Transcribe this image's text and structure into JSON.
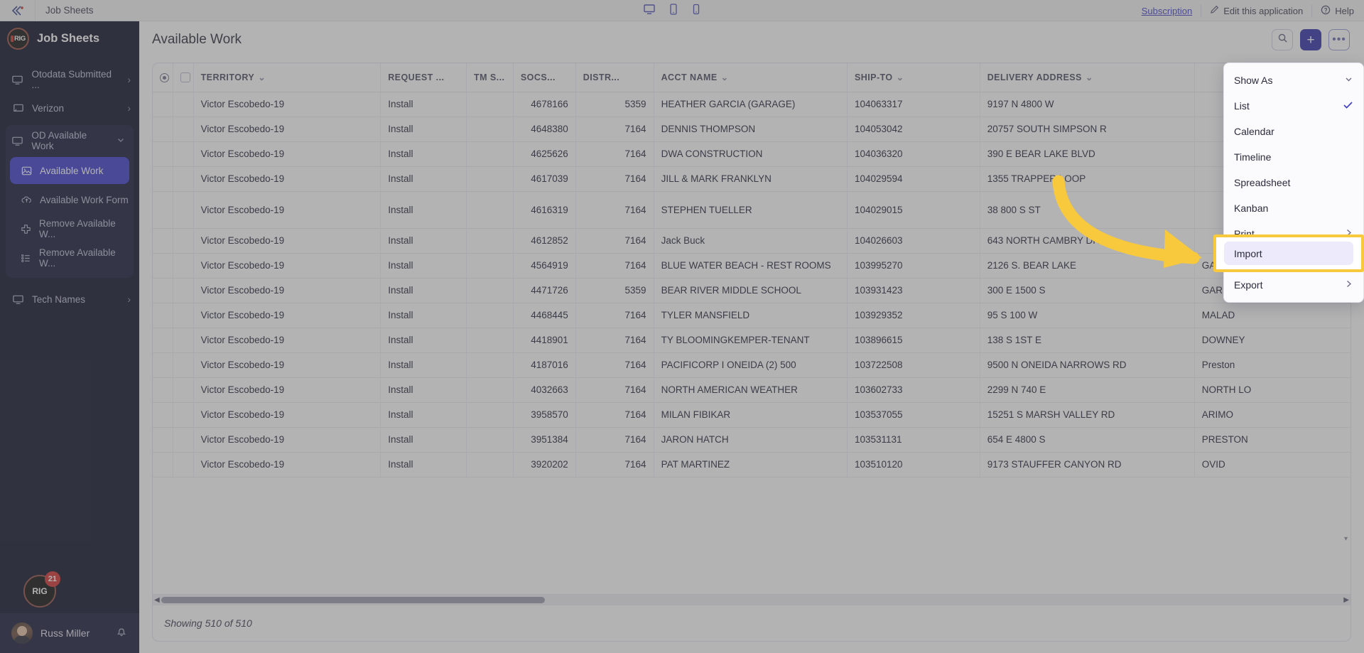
{
  "topbar": {
    "logo_icon": "chevron-logo-icon",
    "title": "Job Sheets",
    "device_icons": [
      "desktop-icon",
      "tablet-icon",
      "mobile-icon"
    ],
    "subscription_label": "Subscription",
    "edit_label": "Edit this application",
    "edit_icon": "pencil-icon",
    "help_label": "Help",
    "help_icon": "help-circle-icon"
  },
  "sidebar": {
    "app_title": "Job Sheets",
    "logo_text": "RIG",
    "items": [
      {
        "label": "Otodata Submitted ...",
        "icon": "monitor-icon",
        "chevron": "›"
      },
      {
        "label": "Verizon",
        "icon": "broadcast-screen-icon",
        "chevron": "›"
      }
    ],
    "group": {
      "label": "OD Available Work",
      "icon": "monitor-icon",
      "chevron": "⌄",
      "children": [
        {
          "label": "Available Work",
          "icon": "image-icon",
          "active": true
        },
        {
          "label": "Available Work Form",
          "icon": "cloud-upload-icon",
          "active": false
        },
        {
          "label": "Remove Available W...",
          "icon": "plus-cross-icon",
          "active": false
        },
        {
          "label": "Remove Available W...",
          "icon": "list-icon",
          "active": false
        }
      ]
    },
    "items_after": [
      {
        "label": "Tech Names",
        "icon": "monitor-icon",
        "chevron": "›"
      }
    ],
    "badge_count": "21",
    "user_name": "Russ Miller",
    "bell_icon": "bell-icon"
  },
  "page": {
    "title": "Available Work",
    "search_icon": "search-icon",
    "add_label": "+",
    "more_label": "•••"
  },
  "table": {
    "columns": [
      {
        "key": "sel",
        "label": ""
      },
      {
        "key": "chk",
        "label": ""
      },
      {
        "key": "territory",
        "label": "TERRITORY",
        "sortable": true
      },
      {
        "key": "request",
        "label": "REQUEST ...",
        "sortable": false
      },
      {
        "key": "tms",
        "label": "TM S...",
        "sortable": false
      },
      {
        "key": "socs",
        "label": "SOCS...",
        "sortable": false
      },
      {
        "key": "distr",
        "label": "DISTR...",
        "sortable": false
      },
      {
        "key": "acct",
        "label": "ACCT NAME",
        "sortable": true
      },
      {
        "key": "shipto",
        "label": "SHIP-TO",
        "sortable": true
      },
      {
        "key": "delivery",
        "label": "DELIVERY ADDRESS",
        "sortable": true
      },
      {
        "key": "city",
        "label": ""
      }
    ],
    "rows": [
      {
        "territory": "Victor Escobedo-19",
        "request": "Install",
        "tms": "",
        "socs": "4678166",
        "distr": "5359",
        "acct": "HEATHER GARCIA (GARAGE)",
        "shipto": "104063317",
        "delivery": "9197 N 4800 W",
        "city": "",
        "tall": false
      },
      {
        "territory": "Victor Escobedo-19",
        "request": "Install",
        "tms": "",
        "socs": "4648380",
        "distr": "7164",
        "acct": "DENNIS THOMPSON",
        "shipto": "104053042",
        "delivery": "20757 SOUTH SIMPSON R",
        "city": "",
        "tall": false
      },
      {
        "territory": "Victor Escobedo-19",
        "request": "Install",
        "tms": "",
        "socs": "4625626",
        "distr": "7164",
        "acct": "DWA CONSTRUCTION",
        "shipto": "104036320",
        "delivery": "390 E BEAR LAKE BLVD",
        "city": "",
        "tall": false
      },
      {
        "territory": "Victor Escobedo-19",
        "request": "Install",
        "tms": "",
        "socs": "4617039",
        "distr": "7164",
        "acct": "JILL & MARK FRANKLYN",
        "shipto": "104029594",
        "delivery": "1355 TRAPPER LOOP",
        "city": "",
        "tall": false
      },
      {
        "territory": "Victor Escobedo-19",
        "request": "Install",
        "tms": "",
        "socs": "4616319",
        "distr": "7164",
        "acct": "STEPHEN TUELLER",
        "shipto": "104029015",
        "delivery": "38  800 S ST",
        "city": "",
        "tall": true
      },
      {
        "territory": "Victor Escobedo-19",
        "request": "Install",
        "tms": "",
        "socs": "4612852",
        "distr": "7164",
        "acct": "Jack Buck",
        "shipto": "104026603",
        "delivery": "643 NORTH CAMBRY DRIV",
        "city": "",
        "tall": false
      },
      {
        "territory": "Victor Escobedo-19",
        "request": "Install",
        "tms": "",
        "socs": "4564919",
        "distr": "7164",
        "acct": "BLUE WATER BEACH - REST ROOMS",
        "shipto": "103995270",
        "delivery": "2126 S. BEAR LAKE",
        "city": "GARDEN C",
        "tall": false
      },
      {
        "territory": "Victor Escobedo-19",
        "request": "Install",
        "tms": "",
        "socs": "4471726",
        "distr": "5359",
        "acct": "BEAR RIVER MIDDLE SCHOOL",
        "shipto": "103931423",
        "delivery": "300 E 1500 S",
        "city": "GARLAND",
        "tall": false
      },
      {
        "territory": "Victor Escobedo-19",
        "request": "Install",
        "tms": "",
        "socs": "4468445",
        "distr": "7164",
        "acct": "TYLER MANSFIELD",
        "shipto": "103929352",
        "delivery": "95 S 100 W",
        "city": "MALAD",
        "tall": false
      },
      {
        "territory": "Victor Escobedo-19",
        "request": "Install",
        "tms": "",
        "socs": "4418901",
        "distr": "7164",
        "acct": "TY BLOOMINGKEMPER-TENANT",
        "shipto": "103896615",
        "delivery": "138 S 1ST E",
        "city": "DOWNEY",
        "tall": false
      },
      {
        "territory": "Victor Escobedo-19",
        "request": "Install",
        "tms": "",
        "socs": "4187016",
        "distr": "7164",
        "acct": "PACIFICORP I ONEIDA (2) 500",
        "shipto": "103722508",
        "delivery": "9500 N ONEIDA NARROWS RD",
        "city": "Preston",
        "tall": false
      },
      {
        "territory": "Victor Escobedo-19",
        "request": "Install",
        "tms": "",
        "socs": "4032663",
        "distr": "7164",
        "acct": "NORTH AMERICAN WEATHER",
        "shipto": "103602733",
        "delivery": "2299 N 740 E",
        "city": "NORTH LO",
        "tall": false
      },
      {
        "territory": "Victor Escobedo-19",
        "request": "Install",
        "tms": "",
        "socs": "3958570",
        "distr": "7164",
        "acct": "MILAN FIBIKAR",
        "shipto": "103537055",
        "delivery": "15251 S MARSH VALLEY RD",
        "city": "ARIMO",
        "tall": false
      },
      {
        "territory": "Victor Escobedo-19",
        "request": "Install",
        "tms": "",
        "socs": "3951384",
        "distr": "7164",
        "acct": "JARON HATCH",
        "shipto": "103531131",
        "delivery": "654 E 4800 S",
        "city": "PRESTON",
        "tall": false
      },
      {
        "territory": "Victor Escobedo-19",
        "request": "Install",
        "tms": "",
        "socs": "3920202",
        "distr": "7164",
        "acct": "PAT MARTINEZ",
        "shipto": "103510120",
        "delivery": "9173 STAUFFER CANYON RD",
        "city": "OVID",
        "tall": false
      }
    ],
    "footer_text": "Showing 510 of 510"
  },
  "menu": {
    "items": [
      {
        "label": "Show As",
        "trailing": "chevron-down-icon",
        "checked": false
      },
      {
        "label": "List",
        "trailing": "check-icon",
        "checked": true
      },
      {
        "label": "Calendar",
        "trailing": "",
        "checked": false
      },
      {
        "label": "Timeline",
        "trailing": "",
        "checked": false
      },
      {
        "label": "Spreadsheet",
        "trailing": "",
        "checked": false
      },
      {
        "label": "Kanban",
        "trailing": "",
        "checked": false
      },
      {
        "label": "Print",
        "trailing": "chevron-right-icon",
        "checked": false
      },
      {
        "label": "Import",
        "trailing": "",
        "checked": false
      },
      {
        "label": "Export",
        "trailing": "chevron-right-icon",
        "checked": false
      }
    ],
    "highlighted_label": "Import"
  },
  "annotation": {
    "arrow_color": "#F8C93C",
    "highlight_border_color": "#F8C93C"
  },
  "colors": {
    "accent": "#3b3bcd",
    "sidebar_bg": "#0e1028",
    "highlight": "#F8C93C"
  }
}
